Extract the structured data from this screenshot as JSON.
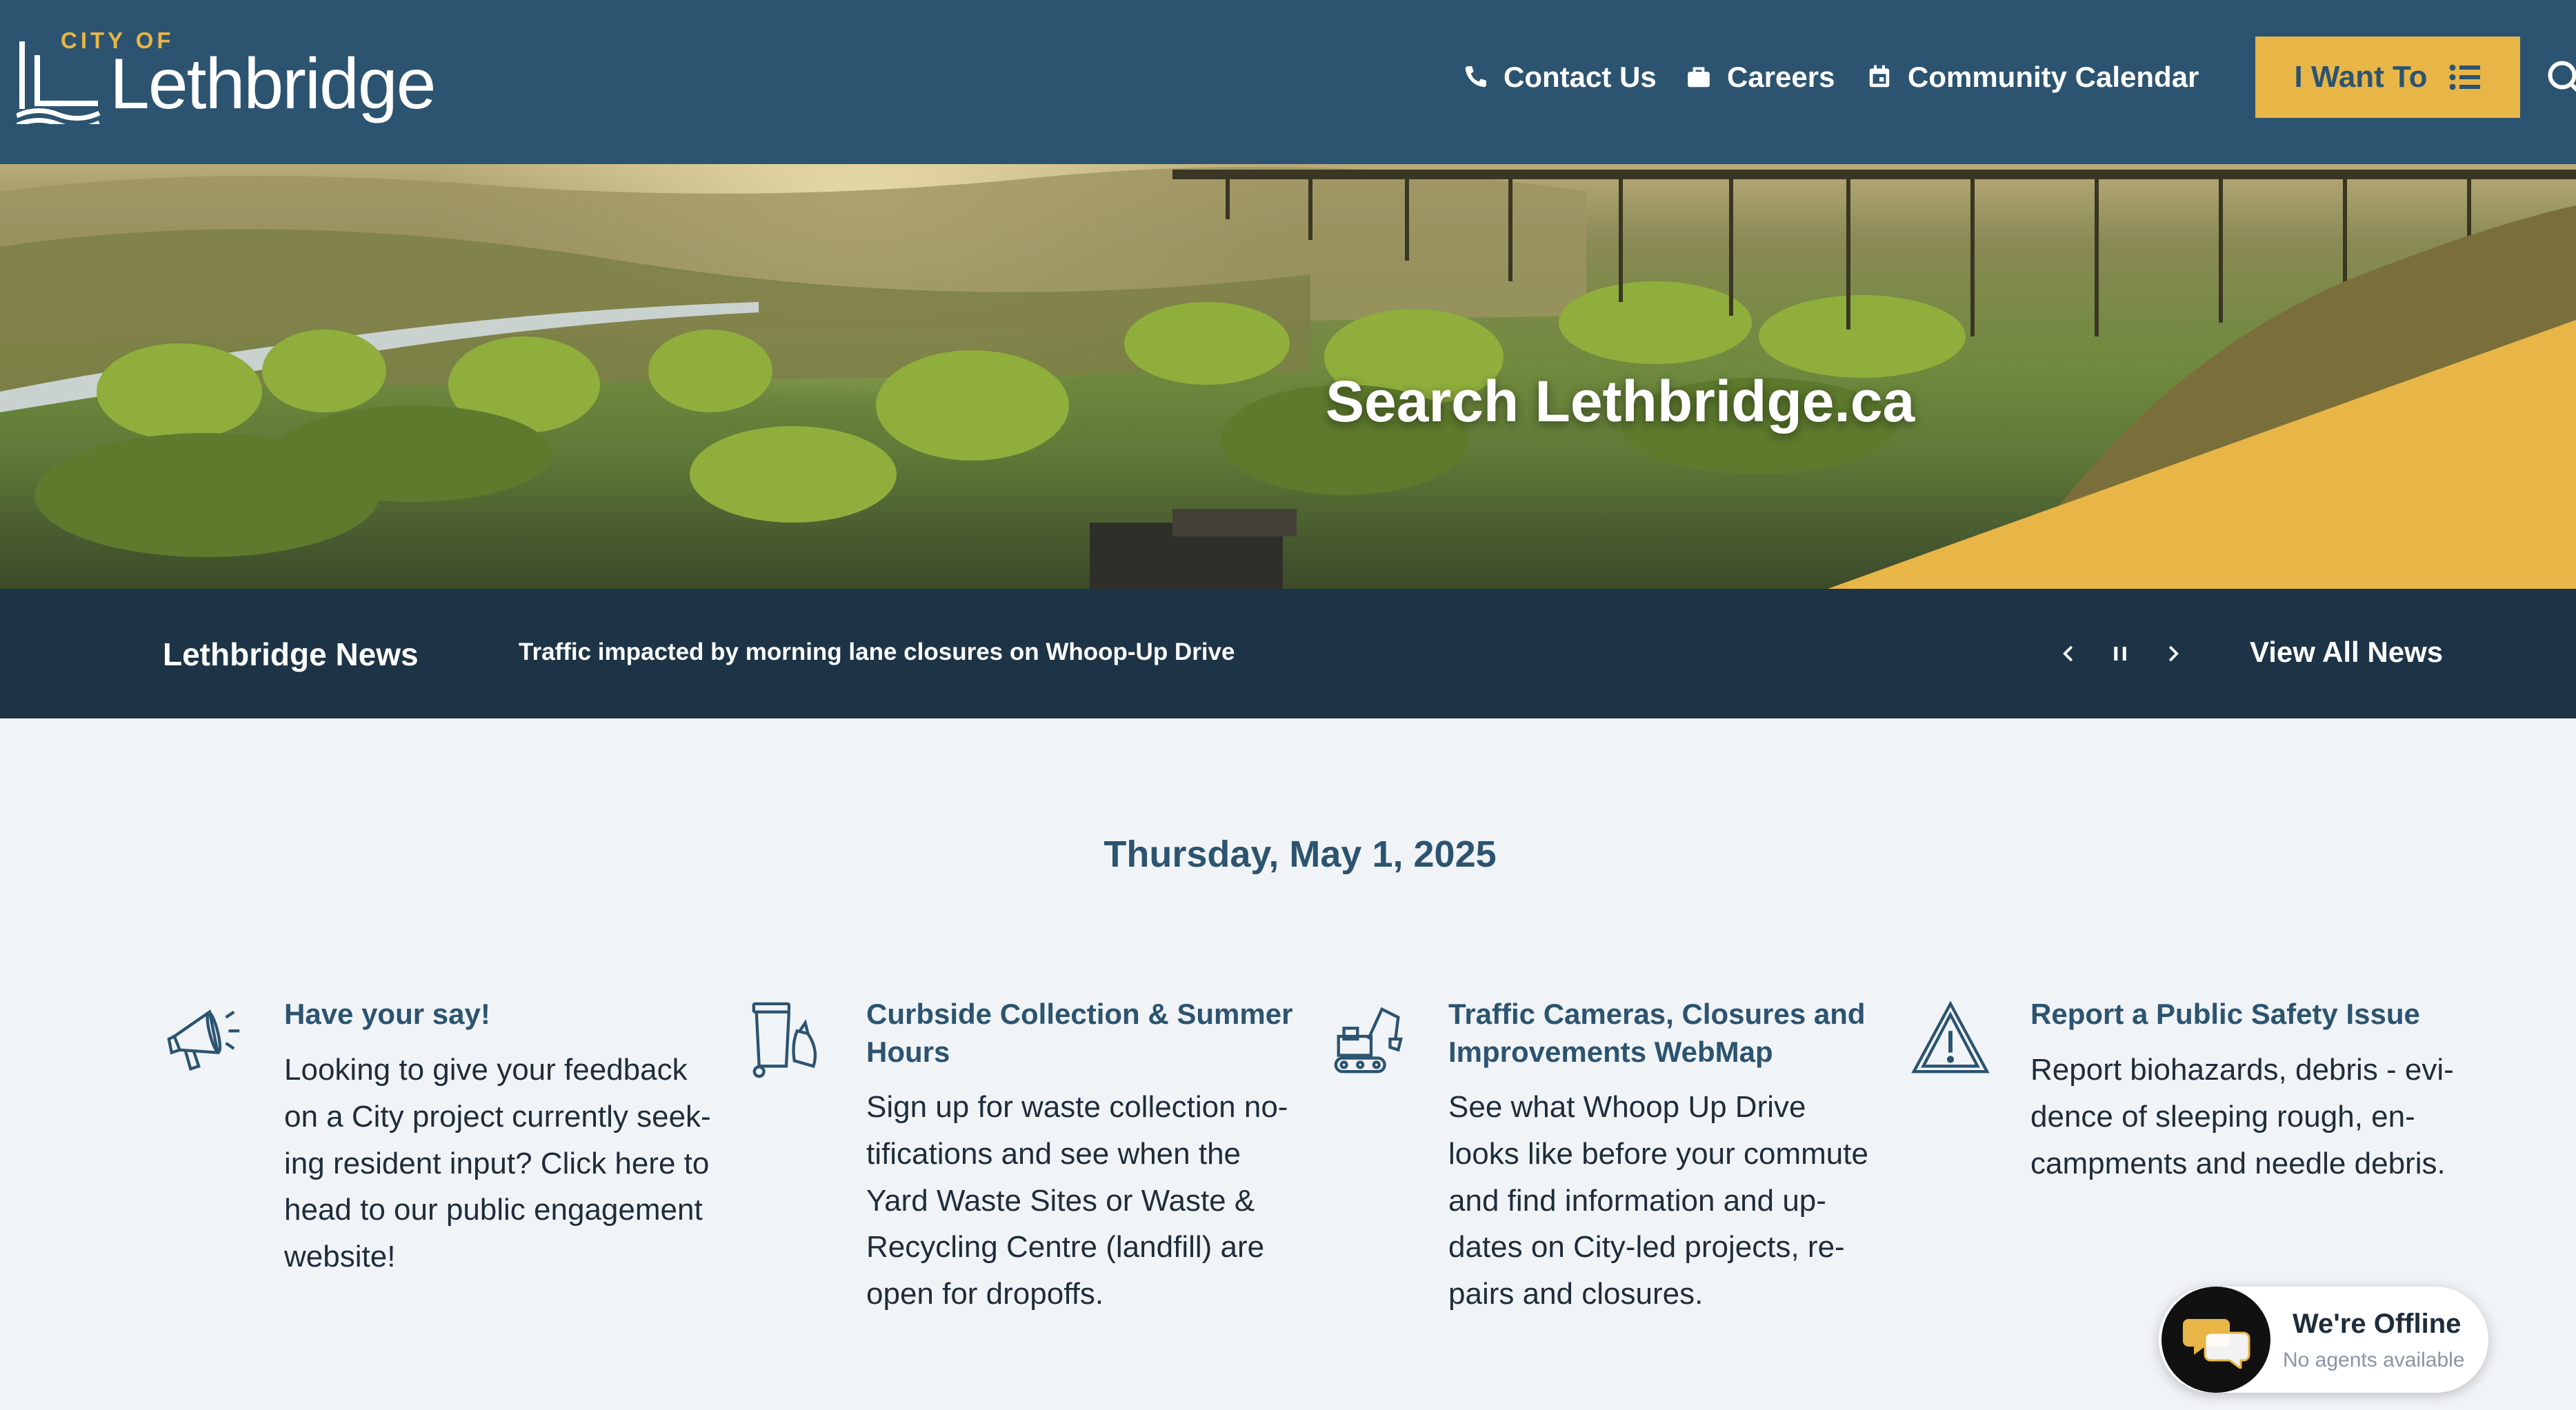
{
  "header": {
    "logo": {
      "city_of": "CITY OF",
      "name": "Lethbridge"
    },
    "nav": [
      {
        "label": "Contact Us",
        "icon": "phone-icon"
      },
      {
        "label": "Careers",
        "icon": "briefcase-icon"
      },
      {
        "label": "Community Calendar",
        "icon": "calendar-icon"
      }
    ],
    "i_want_to": {
      "label": "I Want To",
      "icon": "list-icon"
    },
    "search_icon": "search-icon"
  },
  "hero": {
    "title": "Search Lethbridge.ca"
  },
  "news": {
    "heading": "Lethbridge News",
    "current_item": "Traffic impacted by morning lane closures on Whoop-Up Drive",
    "controls": [
      "chevron-left-icon",
      "pause-icon",
      "chevron-right-icon"
    ],
    "view_all": "View All News"
  },
  "date": "Thursday, May 1, 2025",
  "cards": [
    {
      "icon": "megaphone-icon",
      "title": "Have your say!",
      "text": "Looking to give your feedback on a City project currently seek-ing resident input? Click here to head to our public engagement website!"
    },
    {
      "icon": "waste-bins-icon",
      "title": "Curbside Collection & Summer Hours",
      "text": "Sign up for waste collection no-tifications and see when the Yard Waste Sites or Waste & Recycling Centre (landfill) are open for dropoffs."
    },
    {
      "icon": "excavator-icon",
      "title": "Traffic Cameras, Closures and Improvements WebMap",
      "text": "See what Whoop Up Drive looks like before your commute and find information and up-dates on City-led projects, re-pairs and closures."
    },
    {
      "icon": "warning-icon",
      "title": "Report a Public Safety Issue",
      "text": "Report biohazards, debris - evi-dence of sleeping rough, en-campments and needle debris."
    }
  ],
  "chat": {
    "title": "We're Offline",
    "subtitle": "No agents available",
    "icon": "chat-bubbles-icon"
  },
  "colors": {
    "header_bg": "#2c5470",
    "accent": "#e8b547",
    "news_bg": "#1d3447",
    "page_bg": "#f1f4f7"
  }
}
